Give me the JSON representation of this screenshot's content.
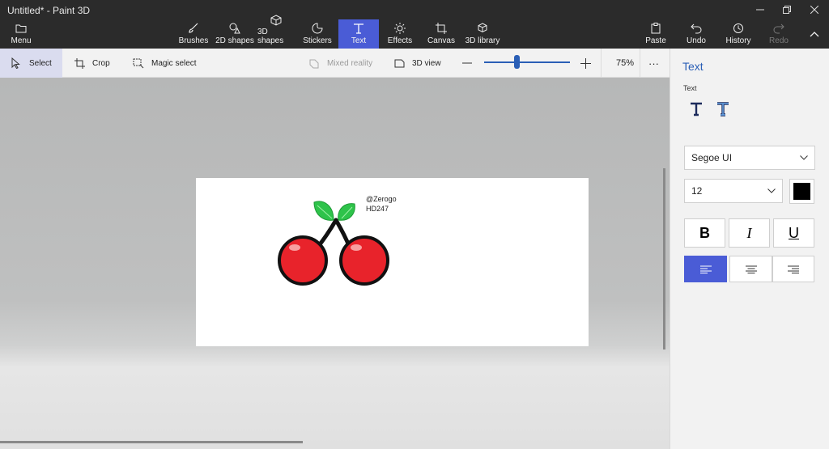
{
  "window": {
    "title": "Untitled* - Paint 3D"
  },
  "ribbon": {
    "menu": "Menu",
    "tools": [
      {
        "label": "Brushes",
        "icon": "brush-icon"
      },
      {
        "label": "2D shapes",
        "icon": "2d-shapes-icon"
      },
      {
        "label": "3D shapes",
        "icon": "3d-shapes-icon"
      },
      {
        "label": "Stickers",
        "icon": "stickers-icon"
      },
      {
        "label": "Text",
        "icon": "text-icon",
        "active": true
      },
      {
        "label": "Effects",
        "icon": "effects-icon"
      },
      {
        "label": "Canvas",
        "icon": "canvas-icon"
      },
      {
        "label": "3D library",
        "icon": "3d-library-icon"
      }
    ],
    "paste": "Paste",
    "undo": "Undo",
    "history": "History",
    "redo": "Redo"
  },
  "subtoolbar": {
    "select": "Select",
    "crop": "Crop",
    "magic_select": "Magic select",
    "mixed_reality": "Mixed reality",
    "view_3d": "3D view",
    "zoom_level": "75%",
    "zoom_fraction": 0.38
  },
  "canvas": {
    "text_line1": "@Zerogo",
    "text_line2": "HD247"
  },
  "panel": {
    "title": "Text",
    "subtitle": "Text",
    "font": "Segoe UI",
    "size": "12",
    "color": "#000000",
    "bold": "B",
    "italic": "I",
    "underline": "U",
    "alignment": "left"
  },
  "colors": {
    "accent": "#4a5cd6",
    "link": "#2a5fb6",
    "cherry": "#e8232b",
    "leaf": "#2ec34a"
  }
}
